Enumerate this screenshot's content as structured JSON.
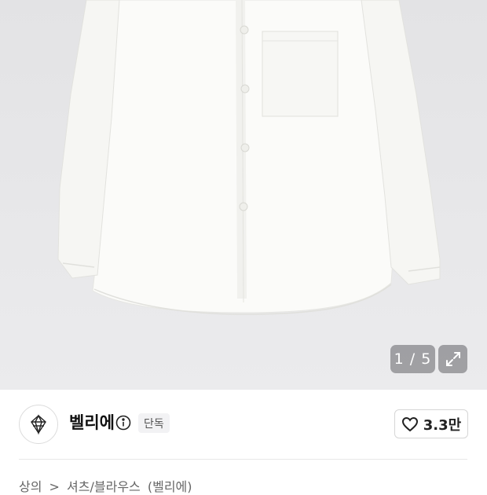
{
  "gallery": {
    "counter": "1 / 5",
    "expand_icon": "expand-arrows-icon"
  },
  "seller": {
    "logo_icon": "brand-logo-icon",
    "name": "벨리에",
    "info_icon": "info-icon",
    "badge": "단독",
    "like_icon": "heart-icon",
    "like_count": "3.3만"
  },
  "breadcrumb": {
    "items": [
      "상의",
      ">",
      "셔츠/블라우스",
      "(벨리에)"
    ]
  },
  "colors": {
    "hero_bg": "#e5e5e7",
    "overlay": "#828287",
    "text_primary": "#111111"
  }
}
